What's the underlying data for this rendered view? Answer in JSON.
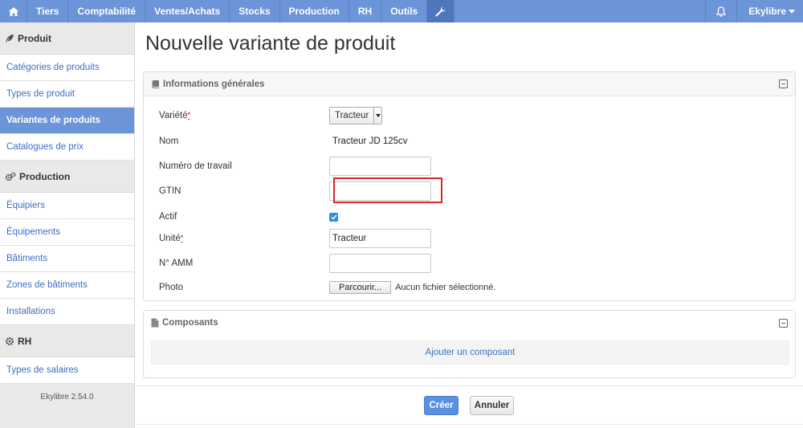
{
  "navbar": {
    "home_icon": "home-icon",
    "items": [
      "Tiers",
      "Comptabilité",
      "Ventes/Achats",
      "Stocks",
      "Production",
      "RH",
      "Outils"
    ],
    "settings_icon": "wrench-icon",
    "notifications_icon": "bell-icon",
    "user": "Ekylibre"
  },
  "sidebar": {
    "sections": [
      {
        "title": "Produit",
        "icon": "feather-icon",
        "items": [
          "Catégories de produits",
          "Types de produit",
          "Variantes de produits",
          "Catalogues de prix"
        ],
        "active": "Variantes de produits"
      },
      {
        "title": "Production",
        "icon": "gears-icon",
        "items": [
          "Équipiers",
          "Équipements",
          "Bâtiments",
          "Zones de bâtiments",
          "Installations"
        ]
      },
      {
        "title": "RH",
        "icon": "gear-icon",
        "items": [
          "Types de salaires"
        ]
      }
    ],
    "version": "Ekylibre 2.54.0"
  },
  "page": {
    "title": "Nouvelle variante de produit"
  },
  "general_panel": {
    "title": "Informations générales",
    "icon": "book-icon",
    "fields": {
      "variety": {
        "label": "Variété",
        "required_mark": "*",
        "value": "Tracteur"
      },
      "name": {
        "label": "Nom",
        "value": "Tracteur JD 125cv"
      },
      "work_number": {
        "label": "Numéro de travail",
        "value": ""
      },
      "gtin": {
        "label": "GTIN",
        "value": ""
      },
      "active": {
        "label": "Actif",
        "checked": true
      },
      "unit": {
        "label": "Unité",
        "required_mark": "*",
        "value": "Tracteur"
      },
      "amm": {
        "label": "N° AMM",
        "value": ""
      },
      "photo": {
        "label": "Photo",
        "browse_label": "Parcourir...",
        "no_file_text": "Aucun fichier sélectionné."
      }
    }
  },
  "components_panel": {
    "title": "Composants",
    "icon": "file-icon",
    "add_label": "Ajouter un composant"
  },
  "actions": {
    "create_label": "Créer",
    "cancel_label": "Annuler"
  },
  "colors": {
    "navbar": "#6c94d8",
    "active_sidebar": "#6c94d8",
    "link": "#3f6ec2",
    "primary_button": "#5b8fe0",
    "highlight_box": "#d9262c"
  }
}
